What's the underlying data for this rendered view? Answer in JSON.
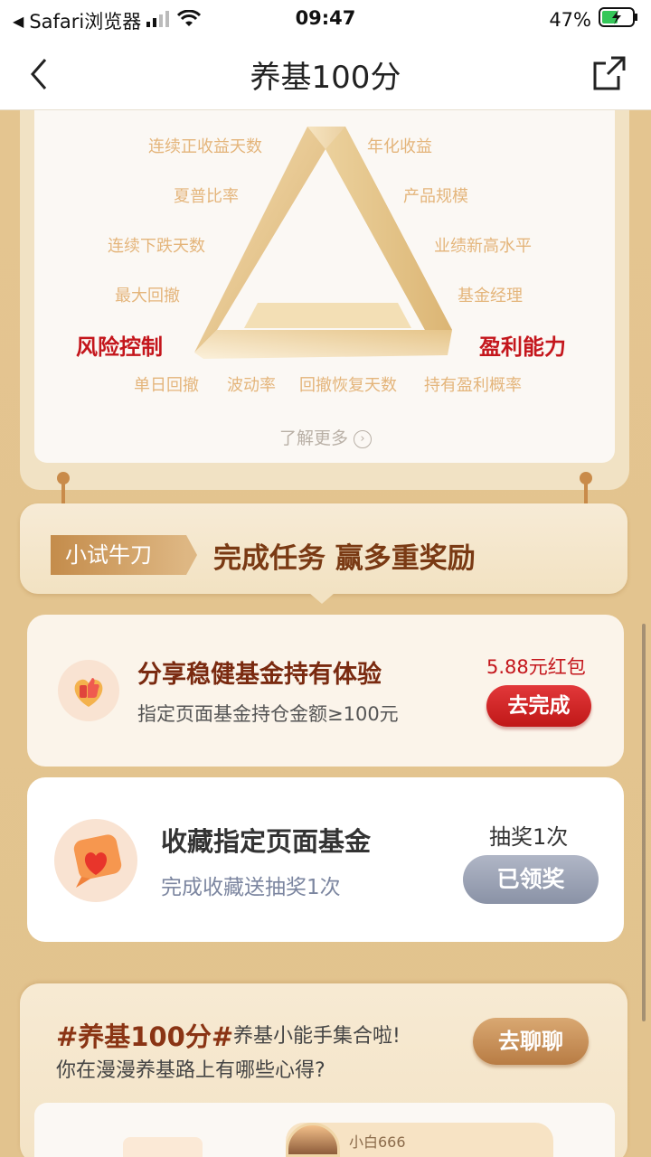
{
  "status": {
    "carrier": "Safari浏览器",
    "time": "09:47",
    "battery": "47%"
  },
  "nav": {
    "title": "养基100分"
  },
  "triangle": {
    "left_labels": [
      "连续正收益天数",
      "夏普比率",
      "连续下跌天数",
      "最大回撤"
    ],
    "right_labels": [
      "年化收益",
      "产品规模",
      "业绩新高水平",
      "基金经理"
    ],
    "bottom_labels": [
      "单日回撤",
      "波动率",
      "回撤恢复天数",
      "持有盈利概率"
    ],
    "risk": "风险控制",
    "profit": "盈利能力",
    "learn_more": "了解更多"
  },
  "tasks": {
    "tag": "小试牛刀",
    "title": "完成任务 赢多重奖励",
    "items": [
      {
        "title": "分享稳健基金持有体验",
        "sub": "指定页面基金持仓金额≥100元",
        "reward": "5.88元红包",
        "button": "去完成"
      },
      {
        "title": "收藏指定页面基金",
        "sub": "完成收藏送抽奖1次",
        "reward": "抽奖1次",
        "button": "已领奖"
      }
    ]
  },
  "talk": {
    "hashtag": "#养基100分#",
    "line1": "养基小能手集合啦!",
    "line2": "你在漫漫养基路上有哪些心得?",
    "button": "去聊聊",
    "user": "小白666"
  },
  "colors": {
    "brand_red": "#c4161c",
    "gold": "#e4b57b",
    "brown": "#7a3a14"
  }
}
